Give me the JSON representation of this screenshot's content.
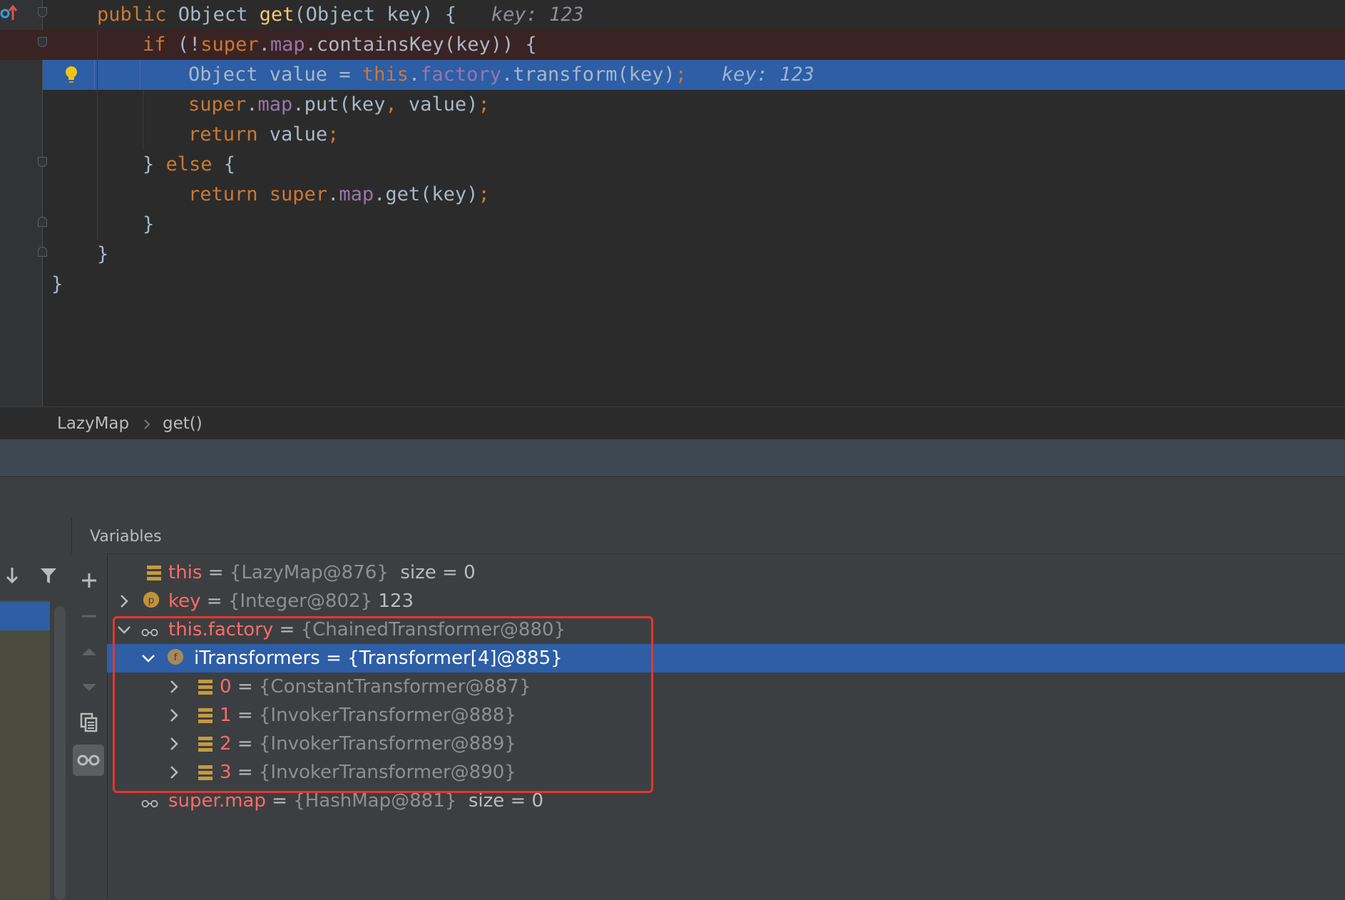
{
  "editor": {
    "lines": [
      {
        "code": "public Object get(Object key) {",
        "hint": "key: 123"
      },
      {
        "code": "if (!super.map.containsKey(key)) {"
      },
      {
        "code": "Object value = this.factory.transform(key);",
        "hint": "key: 123"
      },
      {
        "code": "super.map.put(key, value);"
      },
      {
        "code": "return value;"
      },
      {
        "code": "} else {"
      },
      {
        "code": "return super.map.get(key);"
      },
      {
        "code": "}"
      },
      {
        "code": "}"
      },
      {
        "code": "}"
      }
    ]
  },
  "breadcrumbs": [
    "LazyMap",
    "get()"
  ],
  "variables": {
    "title": "Variables",
    "rows": [
      {
        "name": "this",
        "eq": "=",
        "value": "{LazyMap@876}",
        "extra": "size = 0",
        "icon": "list-icon"
      },
      {
        "name": "key",
        "eq": "=",
        "value": "{Integer@802}",
        "extra": "123",
        "icon": "parameter-icon"
      },
      {
        "name": "this.factory",
        "eq": "=",
        "value": "{ChainedTransformer@880}",
        "extra": "",
        "icon": "watch-icon"
      },
      {
        "name": "iTransformers",
        "eq": "=",
        "value": "{Transformer[4]@885}",
        "extra": "",
        "icon": "field-icon"
      },
      {
        "name": "0",
        "eq": "=",
        "value": "{ConstantTransformer@887}",
        "extra": "",
        "icon": "list-icon"
      },
      {
        "name": "1",
        "eq": "=",
        "value": "{InvokerTransformer@888}",
        "extra": "",
        "icon": "list-icon"
      },
      {
        "name": "2",
        "eq": "=",
        "value": "{InvokerTransformer@889}",
        "extra": "",
        "icon": "list-icon"
      },
      {
        "name": "3",
        "eq": "=",
        "value": "{InvokerTransformer@890}",
        "extra": "",
        "icon": "list-icon"
      },
      {
        "name": "super.map",
        "eq": "=",
        "value": "{HashMap@881}",
        "extra": "size = 0",
        "icon": "watch-icon"
      }
    ]
  },
  "colors": {
    "accent_selection": "#2d5ea6",
    "breakpoint_line": "#3a2323",
    "highlight_box": "#e4362e",
    "keyword": "#cc7832",
    "method": "#ffc66d",
    "field": "#9876aa"
  },
  "icons": [
    "step-out-icon",
    "breakpoint-icon",
    "lightbulb-icon",
    "step-into-icon",
    "filter-icon",
    "add-watch-icon",
    "remove-watch-icon",
    "move-up-icon",
    "move-down-icon",
    "copy-icon",
    "show-watches-icon"
  ]
}
